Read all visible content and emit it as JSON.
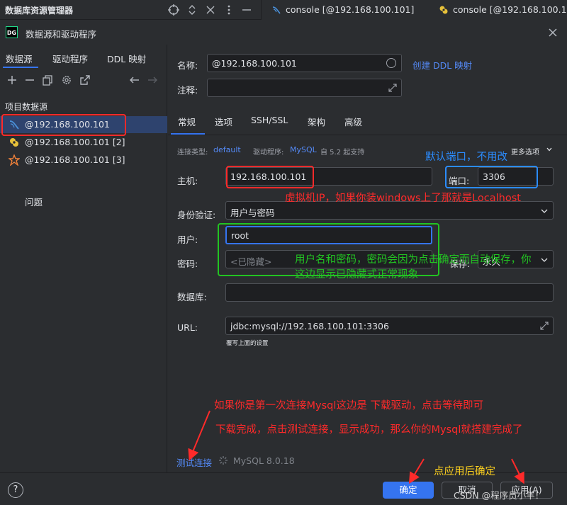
{
  "topbar": {
    "title": "数据库资源管理器",
    "tabs": [
      {
        "label": "console [@192.168.100.101]",
        "icon": "mysql-console-icon"
      },
      {
        "label": "console [@192.168.100.10",
        "icon": "console-icon"
      }
    ]
  },
  "dialog": {
    "logo": "DG",
    "title": "数据源和驱动程序"
  },
  "left": {
    "tabs": [
      "数据源",
      "驱动程序",
      "DDL 映射"
    ],
    "section_label": "项目数据源",
    "datasources": [
      {
        "label": "@192.168.100.101",
        "icon": "mysql-icon",
        "selected": true
      },
      {
        "label": "@192.168.100.101 [2]",
        "icon": "datasource-yellow-icon",
        "selected": false
      },
      {
        "label": "@192.168.100.101 [3]",
        "icon": "datasource-orange-icon",
        "selected": false
      }
    ],
    "problems_label": "问题"
  },
  "right": {
    "name_label": "名称:",
    "name_value": "@192.168.100.101",
    "ddl_link": "创建 DDL 映射",
    "comment_label": "注释:",
    "comment_value": "",
    "subtabs": [
      "常规",
      "选项",
      "SSH/SSL",
      "架构",
      "高级"
    ],
    "conn_type_label": "连接类型:",
    "conn_type_value": "default",
    "driver_label": "驱动程序:",
    "driver_value": "MySQL",
    "driver_note": "自 5.2 起支持",
    "more_options": "更多选项",
    "host_label": "主机:",
    "host_value": "192.168.100.101",
    "port_label": "端口:",
    "port_value": "3306",
    "auth_label": "身份验证:",
    "auth_value": "用户与密码",
    "user_label": "用户:",
    "user_value": "root",
    "password_label": "密码:",
    "password_placeholder": "<已隐藏>",
    "save_label": "保存:",
    "save_value": "永久",
    "database_label": "数据库:",
    "database_value": "",
    "url_label": "URL:",
    "url_value": "jdbc:mysql://192.168.100.101:3306",
    "url_note": "覆写上面的设置",
    "test_link": "测试连接",
    "mysql_version": "MySQL 8.0.18"
  },
  "buttons": {
    "ok": "确定",
    "cancel": "取消",
    "apply": "应用(A)"
  },
  "watermark": "CSDN @程序员小羊！",
  "annotations": {
    "port_note": "默认端口，不用改",
    "host_note": "虚拟机IP，如果你装windows上了那就是Localhost",
    "cred_note_line1": "用户名和密码，密码会因为点击确定而自动保存，你",
    "cred_note_line2": "这边显示已隐藏式正常现象",
    "driver_note": "如果你是第一次连接Mysql这边是 下载驱动，点击等待即可",
    "test_note": "下载完成，点击测试连接，显示成功，那么你的Mysql就搭建完成了",
    "apply_note": "点应用后确定"
  },
  "colors": {
    "accent": "#3574f0",
    "background": "#2b2d30",
    "field_bg": "#1e1f22",
    "annotation_red": "#ff2a2a",
    "annotation_green": "#22c422",
    "annotation_blue": "#2b8cff",
    "annotation_yellow": "#ffd21e"
  }
}
